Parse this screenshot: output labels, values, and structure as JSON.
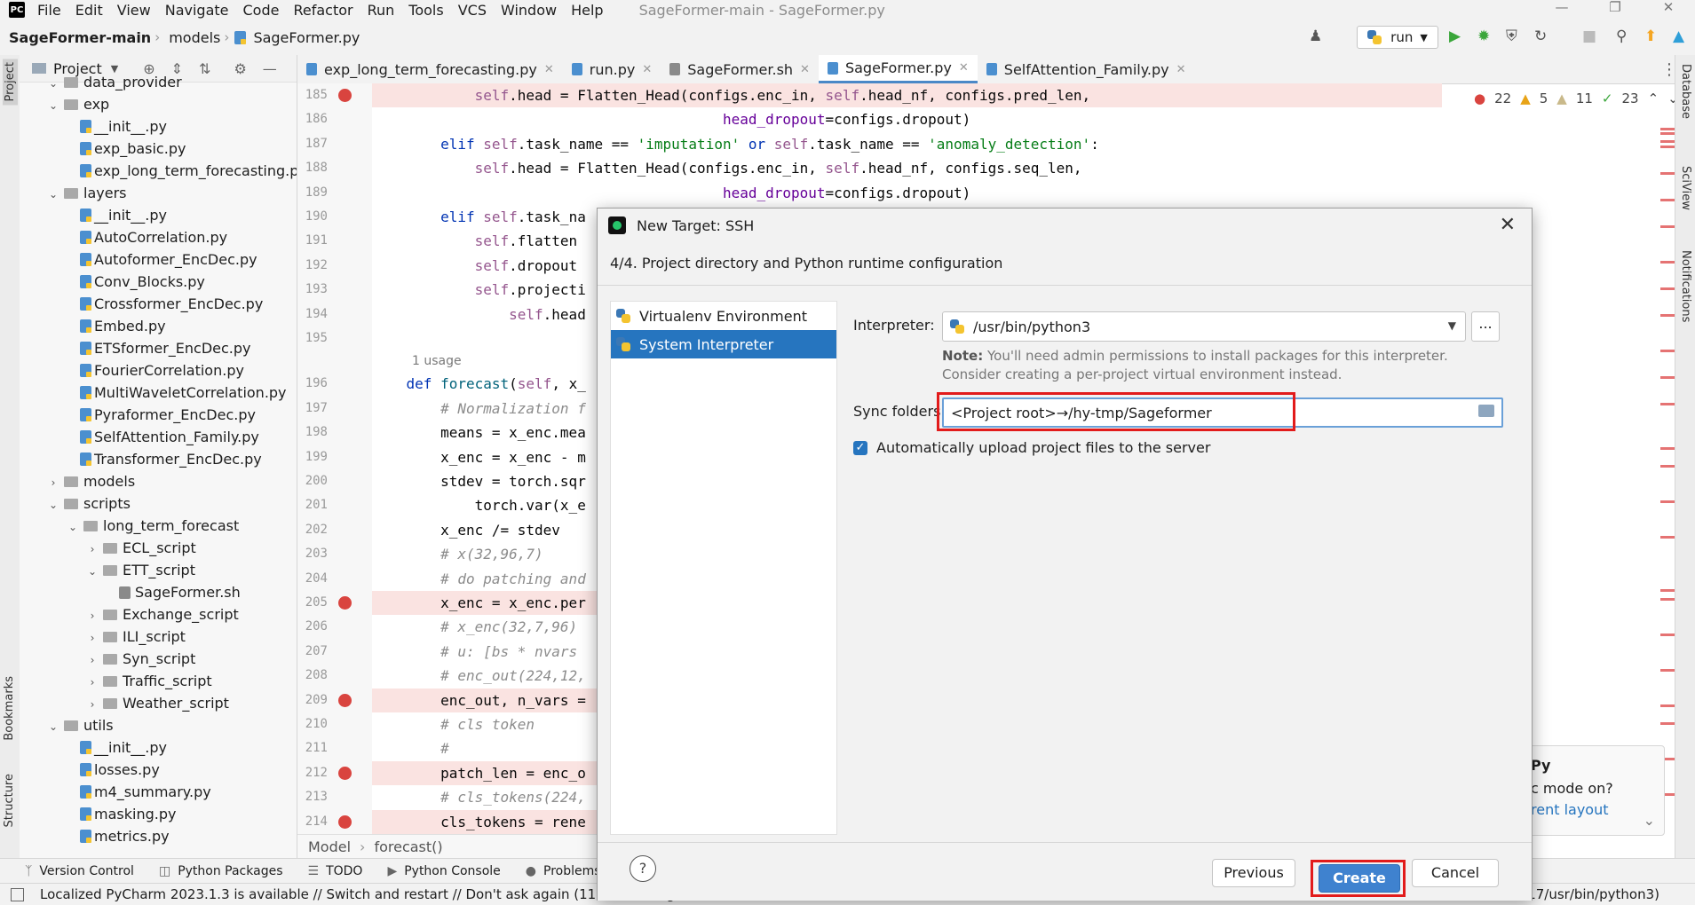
{
  "menu": {
    "items": [
      "File",
      "Edit",
      "View",
      "Navigate",
      "Code",
      "Refactor",
      "Run",
      "Tools",
      "VCS",
      "Window",
      "Help"
    ],
    "window_title": "SageFormer-main - SageFormer.py"
  },
  "nav": {
    "project": "SageFormer-main",
    "folder": "models",
    "file": "SageFormer.py",
    "run_config": "run"
  },
  "left_strip": {
    "project_label": "Project",
    "bookmarks_label": "Bookmarks",
    "structure_label": "Structure"
  },
  "right_strip": {
    "database_label": "Database",
    "sciview_label": "SciView",
    "notifications_label": "Notifications"
  },
  "project_panel": {
    "title": "Project",
    "tree": [
      {
        "label": "data_provider",
        "depth": 1,
        "kind": "folder",
        "expanded": true
      },
      {
        "label": "exp",
        "depth": 1,
        "kind": "folder",
        "expanded": true
      },
      {
        "label": "__init__.py",
        "depth": 2,
        "kind": "py"
      },
      {
        "label": "exp_basic.py",
        "depth": 2,
        "kind": "py"
      },
      {
        "label": "exp_long_term_forecasting.p",
        "depth": 2,
        "kind": "py"
      },
      {
        "label": "layers",
        "depth": 1,
        "kind": "folder",
        "expanded": true
      },
      {
        "label": "__init__.py",
        "depth": 2,
        "kind": "py"
      },
      {
        "label": "AutoCorrelation.py",
        "depth": 2,
        "kind": "py"
      },
      {
        "label": "Autoformer_EncDec.py",
        "depth": 2,
        "kind": "py"
      },
      {
        "label": "Conv_Blocks.py",
        "depth": 2,
        "kind": "py"
      },
      {
        "label": "Crossformer_EncDec.py",
        "depth": 2,
        "kind": "py"
      },
      {
        "label": "Embed.py",
        "depth": 2,
        "kind": "py"
      },
      {
        "label": "ETSformer_EncDec.py",
        "depth": 2,
        "kind": "py"
      },
      {
        "label": "FourierCorrelation.py",
        "depth": 2,
        "kind": "py"
      },
      {
        "label": "MultiWaveletCorrelation.py",
        "depth": 2,
        "kind": "py"
      },
      {
        "label": "Pyraformer_EncDec.py",
        "depth": 2,
        "kind": "py"
      },
      {
        "label": "SelfAttention_Family.py",
        "depth": 2,
        "kind": "py"
      },
      {
        "label": "Transformer_EncDec.py",
        "depth": 2,
        "kind": "py"
      },
      {
        "label": "models",
        "depth": 1,
        "kind": "folder",
        "expanded": false
      },
      {
        "label": "scripts",
        "depth": 1,
        "kind": "folder",
        "expanded": true
      },
      {
        "label": "long_term_forecast",
        "depth": 2,
        "kind": "folder",
        "expanded": true
      },
      {
        "label": "ECL_script",
        "depth": 3,
        "kind": "folder",
        "expanded": false
      },
      {
        "label": "ETT_script",
        "depth": 3,
        "kind": "folder",
        "expanded": true
      },
      {
        "label": "SageFormer.sh",
        "depth": 4,
        "kind": "sh"
      },
      {
        "label": "Exchange_script",
        "depth": 3,
        "kind": "folder",
        "expanded": false
      },
      {
        "label": "ILI_script",
        "depth": 3,
        "kind": "folder",
        "expanded": false
      },
      {
        "label": "Syn_script",
        "depth": 3,
        "kind": "folder",
        "expanded": false
      },
      {
        "label": "Traffic_script",
        "depth": 3,
        "kind": "folder",
        "expanded": false
      },
      {
        "label": "Weather_script",
        "depth": 3,
        "kind": "folder",
        "expanded": false
      },
      {
        "label": "utils",
        "depth": 1,
        "kind": "folder",
        "expanded": true
      },
      {
        "label": "__init__.py",
        "depth": 2,
        "kind": "py"
      },
      {
        "label": "losses.py",
        "depth": 2,
        "kind": "py"
      },
      {
        "label": "m4_summary.py",
        "depth": 2,
        "kind": "py"
      },
      {
        "label": "masking.py",
        "depth": 2,
        "kind": "py"
      },
      {
        "label": "metrics.py",
        "depth": 2,
        "kind": "py"
      }
    ]
  },
  "tabs": [
    {
      "label": "exp_long_term_forecasting.py",
      "active": false,
      "kind": "py"
    },
    {
      "label": "run.py",
      "active": false,
      "kind": "py"
    },
    {
      "label": "SageFormer.sh",
      "active": false,
      "kind": "sh"
    },
    {
      "label": "SageFormer.py",
      "active": true,
      "kind": "py"
    },
    {
      "label": "SelfAttention_Family.py",
      "active": false,
      "kind": "py"
    }
  ],
  "inspections": {
    "errors": "22",
    "warnings": "5",
    "weak_warnings": "11",
    "typos": "23"
  },
  "editor": {
    "usage_hint": "1 usage",
    "lines": [
      {
        "n": "185",
        "bp": true,
        "html": "            <span class='sf'>self</span>.head = Flatten_Head(configs.enc_in, <span class='sf'>self</span>.head_nf, configs.pred_len,"
      },
      {
        "n": "186",
        "bp": false,
        "html": "                                         <span class='pa'>head_dropout</span>=configs.dropout)"
      },
      {
        "n": "187",
        "bp": false,
        "html": "        <span class='kw'>elif</span> <span class='sf'>self</span>.task_name == <span class='st'>'imputation'</span> <span class='kw'>or</span> <span class='sf'>self</span>.task_name == <span class='st'>'anomaly_detection'</span>:"
      },
      {
        "n": "188",
        "bp": false,
        "html": "            <span class='sf'>self</span>.head = Flatten_Head(configs.enc_in, <span class='sf'>self</span>.head_nf, configs.seq_len,"
      },
      {
        "n": "189",
        "bp": false,
        "html": "                                         <span class='pa'>head_dropout</span>=configs.dropout)"
      },
      {
        "n": "190",
        "bp": false,
        "html": "        <span class='kw'>elif</span> <span class='sf'>self</span>.task_na"
      },
      {
        "n": "191",
        "bp": false,
        "html": "            <span class='sf'>self</span>.flatten"
      },
      {
        "n": "192",
        "bp": false,
        "html": "            <span class='sf'>self</span>.dropout"
      },
      {
        "n": "193",
        "bp": false,
        "html": "            <span class='sf'>self</span>.projecti"
      },
      {
        "n": "194",
        "bp": false,
        "html": "                <span class='sf'>self</span>.head"
      },
      {
        "n": "195",
        "bp": false,
        "html": ""
      },
      {
        "n": "196",
        "bp": false,
        "html": "    <span class='kw'>def</span> <span class='fn'>forecast</span>(<span class='sf'>self</span>, x_"
      },
      {
        "n": "197",
        "bp": false,
        "html": "        <span class='cm'># Normalization f</span>"
      },
      {
        "n": "198",
        "bp": false,
        "html": "        means = x_enc.mea"
      },
      {
        "n": "199",
        "bp": false,
        "html": "        x_enc = x_enc - m"
      },
      {
        "n": "200",
        "bp": false,
        "html": "        stdev = torch.sqr"
      },
      {
        "n": "201",
        "bp": false,
        "html": "            torch.var(x_e"
      },
      {
        "n": "202",
        "bp": false,
        "html": "        x_enc /= stdev"
      },
      {
        "n": "203",
        "bp": false,
        "html": "        <span class='cm'># x(32,96,7)</span>"
      },
      {
        "n": "204",
        "bp": false,
        "html": "        <span class='cm'># do patching and</span>"
      },
      {
        "n": "205",
        "bp": true,
        "html": "        x_enc = x_enc.per"
      },
      {
        "n": "206",
        "bp": false,
        "html": "        <span class='cm'># x_enc(32,7,96)</span>"
      },
      {
        "n": "207",
        "bp": false,
        "html": "        <span class='cm'># u: [bs * nvars</span>"
      },
      {
        "n": "208",
        "bp": false,
        "html": "        <span class='cm'># enc_out(224,12,</span>"
      },
      {
        "n": "209",
        "bp": true,
        "html": "        enc_out, n_vars ="
      },
      {
        "n": "210",
        "bp": false,
        "html": "        <span class='cm'># cls token</span>"
      },
      {
        "n": "211",
        "bp": false,
        "html": "        <span class='cm'>#</span>"
      },
      {
        "n": "212",
        "bp": true,
        "html": "        patch_len = enc_o"
      },
      {
        "n": "213",
        "bp": false,
        "html": "        <span class='cm'># cls_tokens(224,</span>"
      },
      {
        "n": "214",
        "bp": true,
        "html": "        cls_tokens = rene"
      }
    ]
  },
  "crumbs": {
    "class_name": "Model",
    "method_name": "forecast()"
  },
  "notification": {
    "line1": "Py",
    "line2": "c mode on?",
    "line3": "rent layout"
  },
  "dialog": {
    "title": "New Target: SSH",
    "step": "4/4. Project directory and Python runtime configuration",
    "environments": [
      {
        "label": "Virtualenv Environment",
        "selected": false
      },
      {
        "label": "System Interpreter",
        "selected": true
      }
    ],
    "interpreter_label": "Interpreter:",
    "interpreter_value": "/usr/bin/python3",
    "more_label": "...",
    "note_bold": "Note:",
    "note_text": " You'll need admin permissions to install packages for this interpreter. Consider creating a per-project virtual environment instead.",
    "sync_label": "Sync folders:",
    "sync_value": "<Project root>→/hy-tmp/Sageformer",
    "auto_upload_label": "Automatically upload project files to the server",
    "help_label": "?",
    "previous_label": "Previous",
    "create_label": "Create",
    "cancel_label": "Cancel"
  },
  "bottom_tools": [
    {
      "label": "Version Control",
      "icon": "branch-icon"
    },
    {
      "label": "Python Packages",
      "icon": "packages-icon"
    },
    {
      "label": "TODO",
      "icon": "todo-icon"
    },
    {
      "label": "Python Console",
      "icon": "console-icon"
    },
    {
      "label": "Problems",
      "icon": "problems-icon"
    }
  ],
  "status": {
    "message": "Localized PyCharm 2023.1.3 is available // Switch and restart // Don't ask again (11 minutes ago)",
    "right_text": "17/usr/bin/python3)"
  },
  "colors": {
    "accent": "#2675bf",
    "breakpoint": "#d9443f",
    "highlight_box": "#e21b1b"
  }
}
